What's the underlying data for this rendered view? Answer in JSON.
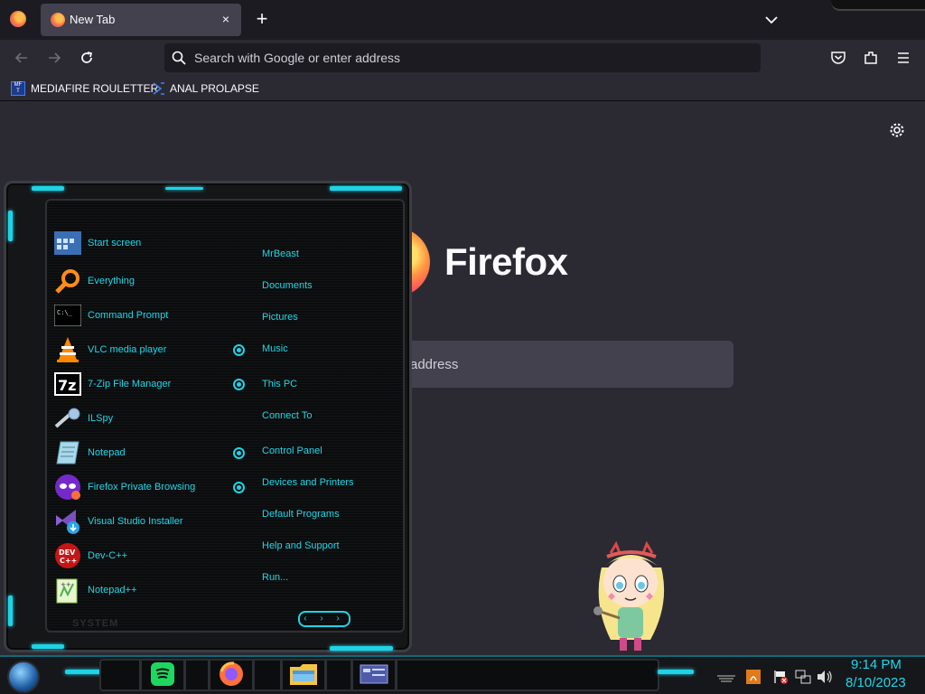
{
  "browser": {
    "tab": {
      "title": "New Tab"
    },
    "new_tab_symbol": "+",
    "close_symbol": "×",
    "urlbar": {
      "placeholder": "Search with Google or enter address"
    },
    "bookmarks": [
      {
        "label": "MEDIAFIRE ROULETTER",
        "icon": "mediafire-icon"
      },
      {
        "label": "ANAL PROLAPSE",
        "icon": "bookmark-sigma-icon"
      }
    ]
  },
  "newtab": {
    "brand": "Firefox",
    "search_text": "address"
  },
  "start_menu": {
    "programs": [
      {
        "label": "Start screen",
        "icon": "start-screen-icon"
      },
      {
        "label": "Everything",
        "icon": "everything-search-icon"
      },
      {
        "label": "Command Prompt",
        "icon": "command-prompt-icon"
      },
      {
        "label": "VLC media player",
        "icon": "vlc-icon"
      },
      {
        "label": "7-Zip File Manager",
        "icon": "7zip-icon"
      },
      {
        "label": "ILSpy",
        "icon": "ilspy-icon"
      },
      {
        "label": "Notepad",
        "icon": "notepad-icon"
      },
      {
        "label": "Firefox Private Browsing",
        "icon": "firefox-private-icon"
      },
      {
        "label": "Visual Studio Installer",
        "icon": "visual-studio-installer-icon"
      },
      {
        "label": "Dev-C++",
        "icon": "devcpp-icon"
      },
      {
        "label": "Notepad++",
        "icon": "notepadpp-icon"
      }
    ],
    "places": [
      {
        "label": "MrBeast"
      },
      {
        "label": "Documents"
      },
      {
        "label": "Pictures"
      },
      {
        "label": "Music"
      },
      {
        "label": "This PC"
      },
      {
        "label": "Connect To"
      },
      {
        "label": "Control Panel"
      },
      {
        "label": "Devices and Printers"
      },
      {
        "label": "Default Programs"
      },
      {
        "label": "Help and Support"
      },
      {
        "label": "Run..."
      }
    ],
    "system_label": "SYSTEM",
    "nav_label": "‹ › ›"
  },
  "taskbar": {
    "apps": [
      "spotify-icon",
      "firefox-icon",
      "file-explorer-icon",
      "control-panel-icon"
    ],
    "clock": {
      "time": "9:14 PM",
      "date": "8/10/2023"
    }
  },
  "colors": {
    "accent_cyan": "#1fd3e6",
    "browser_bg": "#2b2a33",
    "tabstrip_bg": "#1c1b22"
  }
}
